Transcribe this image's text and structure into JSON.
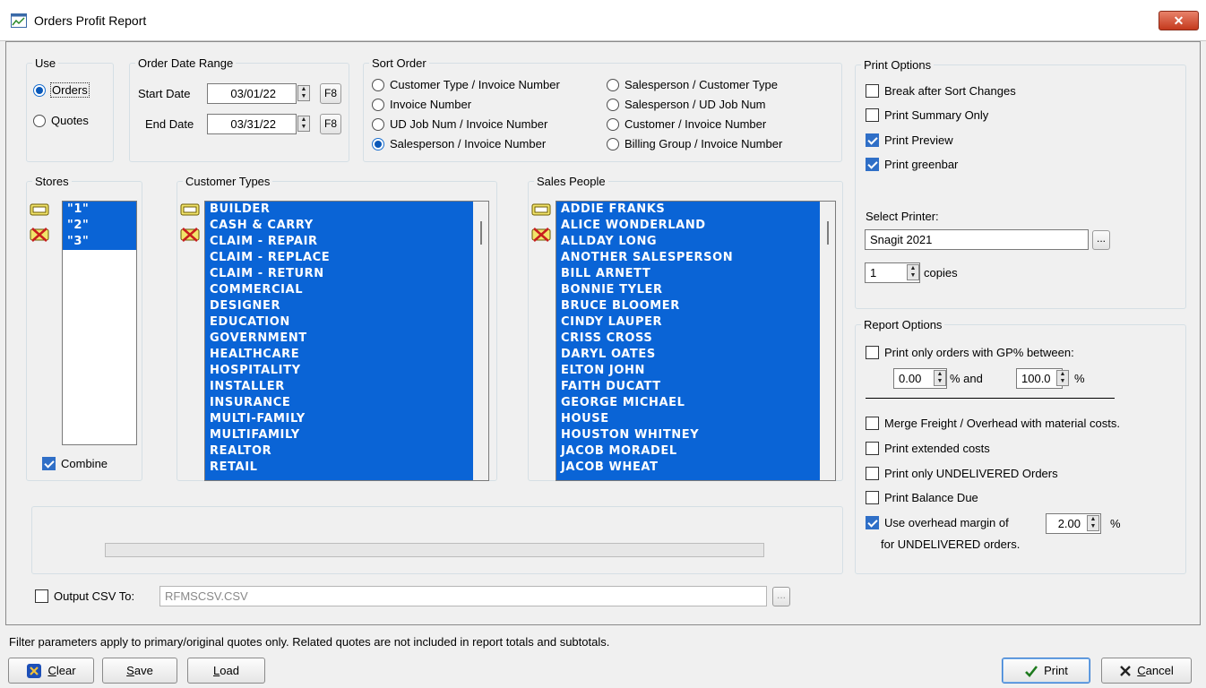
{
  "window": {
    "title": "Orders Profit Report",
    "close_glyph": "✕"
  },
  "use": {
    "legend": "Use",
    "options": [
      {
        "label": "Orders",
        "selected": true
      },
      {
        "label": "Quotes",
        "selected": false
      }
    ]
  },
  "date_range": {
    "legend": "Order Date Range",
    "start_label": "Start Date",
    "start_value": "03/01/22",
    "end_label": "End Date",
    "end_value": "03/31/22",
    "f8_label": "F8"
  },
  "sort_order": {
    "legend": "Sort Order",
    "options": [
      {
        "label": "Customer Type / Invoice Number",
        "selected": false
      },
      {
        "label": "Invoice Number",
        "selected": false
      },
      {
        "label": "UD Job Num / Invoice Number",
        "selected": false
      },
      {
        "label": "Salesperson / Invoice Number",
        "selected": true
      },
      {
        "label": "Salesperson / Customer Type",
        "selected": false
      },
      {
        "label": "Salesperson / UD Job Num",
        "selected": false
      },
      {
        "label": "Customer / Invoice Number",
        "selected": false
      },
      {
        "label": "Billing Group / Invoice Number",
        "selected": false
      }
    ]
  },
  "print_options": {
    "legend": "Print Options",
    "checks": [
      {
        "label": "Break after Sort Changes",
        "checked": false
      },
      {
        "label": "Print Summary Only",
        "checked": false
      },
      {
        "label": "Print Preview",
        "checked": true
      },
      {
        "label": "Print greenbar",
        "checked": true
      }
    ],
    "select_printer_label": "Select Printer:",
    "printer_value": "Snagit 2021",
    "browse_label": "...",
    "copies_value": "1",
    "copies_label": "copies"
  },
  "stores": {
    "legend": "Stores",
    "items": [
      "\"1\"",
      "\"2\"",
      "\"3\""
    ],
    "combine_label": "Combine",
    "combine_checked": true
  },
  "customer_types": {
    "legend": "Customer Types",
    "items": [
      "BUILDER",
      "CASH & CARRY",
      "CLAIM - REPAIR",
      "CLAIM - REPLACE",
      "CLAIM - RETURN",
      "COMMERCIAL",
      "DESIGNER",
      "EDUCATION",
      "GOVERNMENT",
      "HEALTHCARE",
      "HOSPITALITY",
      "INSTALLER",
      "INSURANCE",
      "MULTI-FAMILY",
      "MULTIFAMILY",
      "REALTOR",
      "RETAIL"
    ]
  },
  "sales_people": {
    "legend": "Sales People",
    "items": [
      "ADDIE FRANKS",
      "ALICE WONDERLAND",
      "ALLDAY LONG",
      "ANOTHER SALESPERSON",
      "BILL  ARNETT",
      "BONNIE TYLER",
      "BRUCE BLOOMER",
      "CINDY  LAUPER",
      "CRISS CROSS",
      "DARYL OATES",
      "ELTON JOHN",
      "FAITH DUCATT",
      "GEORGE MICHAEL",
      "HOUSE",
      "HOUSTON WHITNEY",
      "JACOB MORADEL",
      "JACOB WHEAT"
    ]
  },
  "report_options": {
    "legend": "Report Options",
    "gp_label": "Print only orders with GP% between:",
    "gp_checked": false,
    "gp_min": "0.00",
    "gp_and": "% and",
    "gp_max": "100.0",
    "pct": "%",
    "checks": [
      {
        "label": "Merge Freight / Overhead with material costs.",
        "checked": false
      },
      {
        "label": "Print extended costs",
        "checked": false
      },
      {
        "label": "Print only UNDELIVERED Orders",
        "checked": false
      },
      {
        "label": "Print Balance Due",
        "checked": false
      }
    ],
    "overhead_label": "Use overhead margin of",
    "overhead_checked": true,
    "overhead_value": "2.00",
    "overhead_suffix": "for UNDELIVERED orders."
  },
  "csv": {
    "label": "Output CSV To:",
    "checked": false,
    "value": "RFMSCSV.CSV",
    "browse_label": "..."
  },
  "status_text": "Filter parameters apply to primary/original quotes only.  Related quotes are not included in report totals and subtotals.",
  "buttons": {
    "clear_accel": "C",
    "clear_rest": "lear",
    "save_accel": "S",
    "save_rest": "ave",
    "load_accel": "L",
    "load_rest": "oad",
    "print_label": "Print",
    "cancel_accel": "C",
    "cancel_rest": "ancel"
  },
  "colors": {
    "selection": "#0a64d6",
    "checked": "#2f6fc7",
    "radio": "#0a58b8"
  }
}
